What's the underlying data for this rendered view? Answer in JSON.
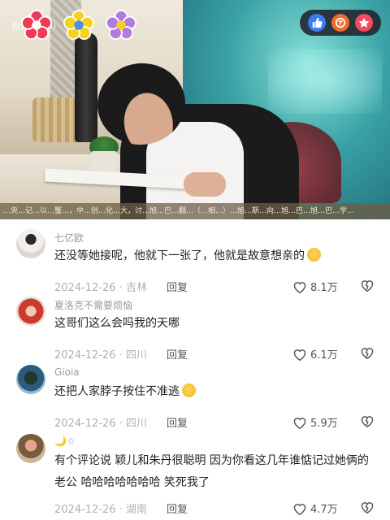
{
  "video": {
    "watermark": "百…大…li",
    "ticker": "…央…记…以…蟹…，中…创…化…大，讨…旭…巴…翻…（…相…）…旭…斯…向…旭…巴…旭…巴…学…"
  },
  "comments": [
    {
      "username": "七亿欧",
      "text": "还没等她接呢，他就下一张了，他就是故意想亲的",
      "emoji": "laughing-tears-emoji",
      "date": "2024-12-26",
      "location": "吉林",
      "reply": "回复",
      "likes": "8.1万"
    },
    {
      "username": "夏洛克不需要烦恼",
      "text": "这哥们这么会吗我的天哪",
      "date": "2024-12-26",
      "location": "四川",
      "reply": "回复",
      "likes": "6.1万"
    },
    {
      "username": "Gioia",
      "text": "还把人家脖子按住不准逃",
      "emoji": "rofl-emoji",
      "date": "2024-12-26",
      "location": "四川",
      "reply": "回复",
      "likes": "5.9万"
    },
    {
      "username": "🌙☆",
      "text": "有个评论说 颖儿和朱丹很聪明 因为你看这几年谁惦记过她俩的老公 哈哈哈哈哈哈哈 笑死我了",
      "date": "2024-12-26",
      "location": "湖南",
      "reply": "回复",
      "likes": "4.7万"
    }
  ],
  "colors": {
    "meta_gray": "#b0b0b0",
    "text_dark": "#1f1f1f",
    "like_gray": "#555555"
  }
}
